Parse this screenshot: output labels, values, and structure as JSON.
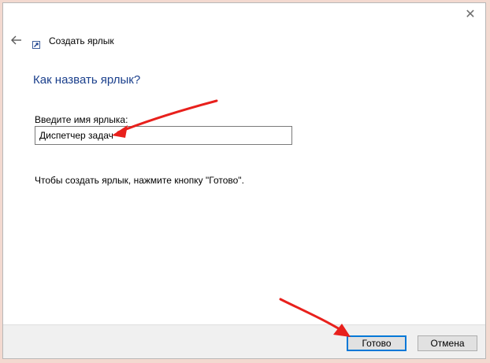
{
  "window": {
    "close_glyph": "✕"
  },
  "wizard": {
    "title": "Создать ярлык",
    "heading": "Как назвать ярлык?",
    "field_label": "Введите имя ярлыка:",
    "field_value": "Диспетчер задач",
    "instruction": "Чтобы создать ярлык, нажмите кнопку \"Готово\"."
  },
  "buttons": {
    "finish": "Готово",
    "cancel": "Отмена"
  },
  "colors": {
    "background": "#f3d9d0",
    "heading": "#1a3f8c",
    "accent": "#0078d7",
    "annotation_arrow": "#e8201c"
  },
  "icons": {
    "back": "back-arrow-icon",
    "shortcut": "shortcut-icon",
    "close": "close-icon"
  }
}
